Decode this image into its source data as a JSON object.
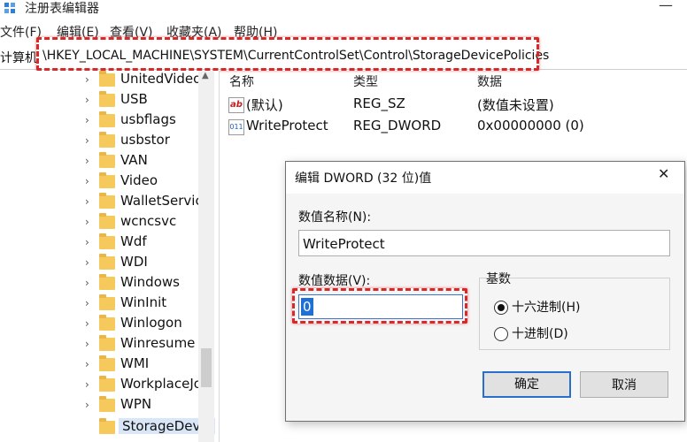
{
  "window": {
    "title": "注册表编辑器",
    "minimize_glyph": "—"
  },
  "menu": [
    {
      "label": "文件(F)"
    },
    {
      "label": "编辑(E)"
    },
    {
      "label": "查看(V)"
    },
    {
      "label": "收藏夹(A)"
    },
    {
      "label": "帮助(H)"
    }
  ],
  "address": {
    "prefix": "计算机",
    "path": "\\HKEY_LOCAL_MACHINE\\SYSTEM\\CurrentControlSet\\Control\\StorageDevicePolicies"
  },
  "tree": {
    "items": [
      {
        "label": "UnitedVideo"
      },
      {
        "label": "USB"
      },
      {
        "label": "usbflags"
      },
      {
        "label": "usbstor"
      },
      {
        "label": "VAN"
      },
      {
        "label": "Video"
      },
      {
        "label": "WalletService"
      },
      {
        "label": "wcncsvc"
      },
      {
        "label": "Wdf"
      },
      {
        "label": "WDI"
      },
      {
        "label": "Windows"
      },
      {
        "label": "WinInit"
      },
      {
        "label": "Winlogon"
      },
      {
        "label": "Winresume"
      },
      {
        "label": "WMI"
      },
      {
        "label": "WorkplaceJo"
      },
      {
        "label": "WPN"
      },
      {
        "label": "StorageDevic"
      }
    ]
  },
  "list": {
    "headers": {
      "name": "名称",
      "type": "类型",
      "data": "数据"
    },
    "rows": [
      {
        "icon": "string-value-icon",
        "name": "(默认)",
        "type": "REG_SZ",
        "data": "(数值未设置)"
      },
      {
        "icon": "dword-value-icon",
        "name": "WriteProtect",
        "type": "REG_DWORD",
        "data": "0x00000000 (0)"
      }
    ]
  },
  "dialog": {
    "title": "编辑 DWORD (32 位)值",
    "close_glyph": "✕",
    "name_label": "数值名称(N):",
    "name_value": "WriteProtect",
    "data_label": "数值数据(V):",
    "data_value": "0",
    "base_label": "基数",
    "base_options": [
      {
        "label": "十六进制(H)",
        "selected": true
      },
      {
        "label": "十进制(D)",
        "selected": false
      }
    ],
    "ok_label": "确定",
    "cancel_label": "取消"
  },
  "colors": {
    "highlight": "#d62a2a",
    "folder": "#f5c95b",
    "selection": "#1e6fd6"
  }
}
